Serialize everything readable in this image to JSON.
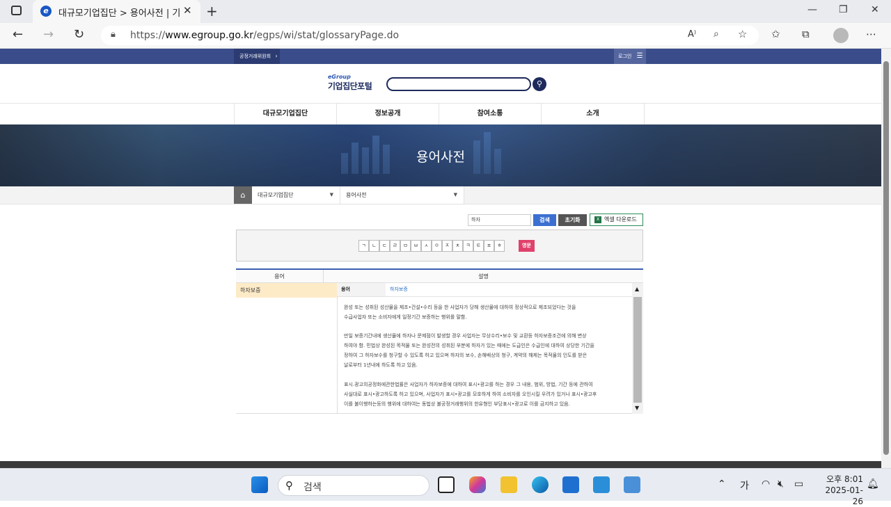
{
  "browser": {
    "tab_title": "대규모기업집단 > 용어사전 | 기업",
    "url_prefix": "https://",
    "url_host": "www.egroup.go.kr",
    "url_path": "/egps/wi/stat/glossaryPage.do"
  },
  "site": {
    "top_link": "공정거래위원회",
    "login": "로그인",
    "logo_small": "eGroup",
    "logo_big": "기업집단포털",
    "nav": [
      "대규모기업집단",
      "정보공개",
      "참여소통",
      "소개"
    ],
    "banner_title": "용어사전",
    "breadcrumb": [
      "대규모기업집단",
      "용어사전"
    ]
  },
  "search": {
    "query": "하자",
    "search_label": "검색",
    "reset_label": "초기화",
    "excel_label": "엑셀 다운로드"
  },
  "consonants": [
    "ㄱ",
    "ㄴ",
    "ㄷ",
    "ㄹ",
    "ㅁ",
    "ㅂ",
    "ㅅ",
    "ㅇ",
    "ㅈ",
    "ㅊ",
    "ㅋ",
    "ㅌ",
    "ㅍ",
    "ㅎ"
  ],
  "english_label": "영문",
  "table": {
    "col_term": "용어",
    "col_desc": "설명",
    "selected_term": "하자보증",
    "detail_label": "용어",
    "detail_value": "하자보증",
    "paragraphs": [
      [
        "완성 또는 성취된 성산물을 제조•건설•수리 등을 한 사업자가 당해 생산물에 대하여 정상적으로 제조되었다는 것을",
        "수급사업자 또는 소비자에게 일정기간 보증하는 행위를 말함."
      ],
      [
        "만일 보증기간내에 생산물에 하자나 문제점이 발생할 경우 사업자는 무상수리•보수 및 교환등 하자보증조건에 의해 변상",
        "하여야 함. 민법상 완성된 목적물 또는 완성전의 성취된 부분에 하자가 있는 때에는 도급인은 수급인에 대하여 상당한 기간을",
        "정하여 그 하자보수를 청구할 수 있도록 하고 있으며 하자의 보수, 손해배상의 청구, 계약의 해제는 목적물의 인도를 받은",
        "날로부터 1년내에 하도록 하고 있음."
      ],
      [
        "표시.광고의공정화에관한법률은 사업자가 하자보증에 대하여 표시•광고를 하는 경우 그 내용, 범위, 방법, 기간 등에 관하여",
        "사실대로 표시•광고하도록 하고 있으며, 사업자가 표시•광고를 모호하게 하여 소비자를 오인시킬 우려가 있거나 표시•광고후",
        "이를 불이행하는등의 행위에 대하여는 동법상 불공정거래행위의 한유형인 부당표시•광고로 이를 금지하고 있음."
      ]
    ]
  },
  "taskbar": {
    "search_placeholder": "검색",
    "ime": "가",
    "time": "오후 8:01",
    "date": "2025-01-26"
  }
}
